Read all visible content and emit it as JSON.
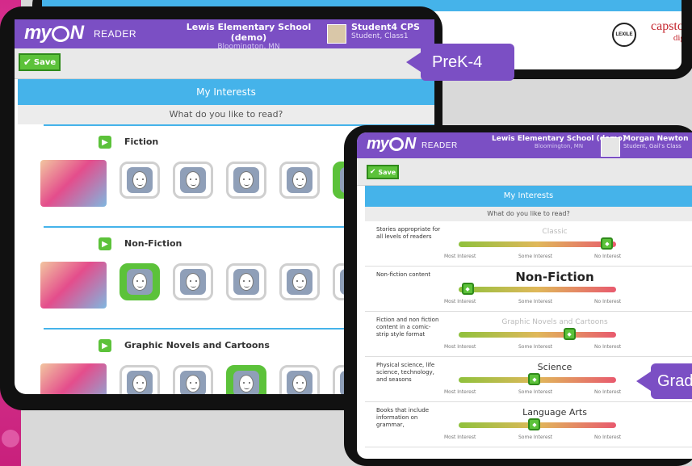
{
  "brand": {
    "logo": "my N",
    "reader": "READER"
  },
  "back_screen": {
    "lexile": "LEXILE",
    "capstone": "capstone",
    "capstone_sub": "digital"
  },
  "prek": {
    "school": "Lewis Elementary School (demo)",
    "city": "Bloomington, MN",
    "user_name": "Student4 CPS",
    "user_role": "Student, Class1",
    "save_label": "Save",
    "title": "My Interests",
    "subtitle": "What do you like to read?",
    "categories": [
      {
        "name": "Fiction",
        "selected_face": 5
      },
      {
        "name": "Non-Fiction",
        "selected_face": 1
      },
      {
        "name": "Graphic Novels and Cartoons",
        "selected_face": 3
      }
    ]
  },
  "grade": {
    "school": "Lewis Elementary School (demo)",
    "city": "Bloomington, MN",
    "user_name": "Morgan Newton",
    "user_role": "Student, Gail's Class",
    "save_label": "Save",
    "title": "My Interests",
    "subtitle": "What do you like to read?",
    "tick_most": "Most Interest",
    "tick_some": "Some Interest",
    "tick_no": "No Interest",
    "rows": [
      {
        "desc": "Stories appropriate for all levels of readers",
        "title": "Classic",
        "level": 0.98
      },
      {
        "desc": "Non-fiction content",
        "title": "Non-Fiction",
        "level": 0.02
      },
      {
        "desc": "Fiction and non fiction content in a comic-strip style format",
        "title": "Graphic Novels and Cartoons",
        "level": 0.72
      },
      {
        "desc": "Physical science, life science, technology, and seasons",
        "title": "Science",
        "level": 0.48
      },
      {
        "desc": "Books that include information on grammar,",
        "title": "Language Arts",
        "level": 0.48
      }
    ]
  },
  "callouts": {
    "prek": "PreK-4",
    "grade": "Grad"
  }
}
